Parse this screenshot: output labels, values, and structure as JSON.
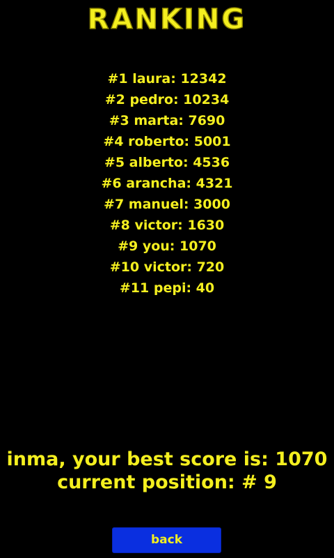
{
  "screen": {
    "title": "Ranking"
  },
  "ranking": [
    {
      "label": "#1 laura: 12342"
    },
    {
      "label": "#2 pedro: 10234"
    },
    {
      "label": "#3 marta: 7690"
    },
    {
      "label": "#4 roberto: 5001"
    },
    {
      "label": "#5 alberto: 4536"
    },
    {
      "label": "#6 arancha: 4321"
    },
    {
      "label": "#7 manuel: 3000"
    },
    {
      "label": "#8 victor: 1630"
    },
    {
      "label": "#9 you: 1070"
    },
    {
      "label": "#10 victor: 720"
    },
    {
      "label": "#11 pepi: 40"
    }
  ],
  "summary": {
    "best_score_text": "inma, your best score is: 1070",
    "position_text": "current position: # 9"
  },
  "buttons": {
    "back_label": "back"
  },
  "colors": {
    "text": "#f4ef1f",
    "background": "#000000",
    "button": "#0a2fe0"
  }
}
